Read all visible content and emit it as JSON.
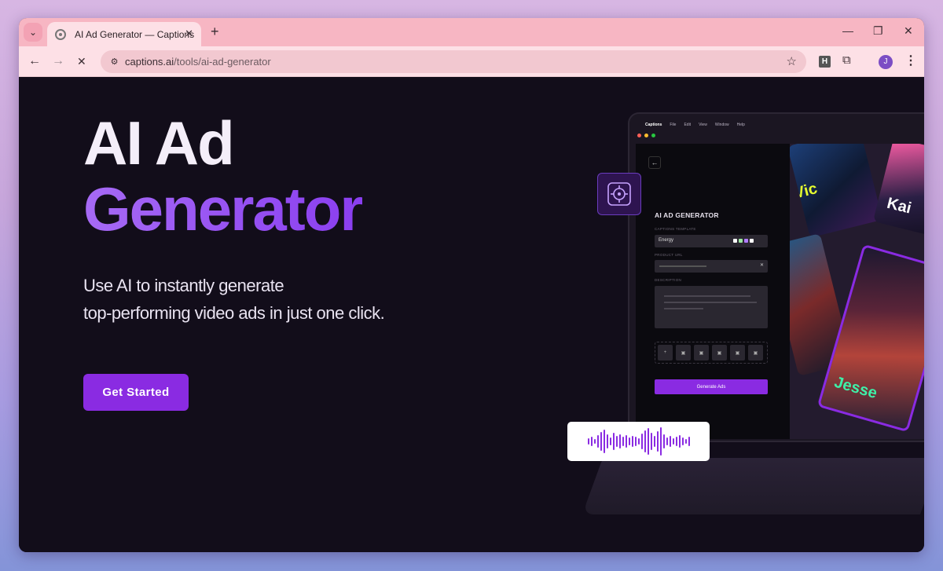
{
  "browser": {
    "tab_title": "AI Ad Generator — Captions",
    "tab_close": "✕",
    "new_tab": "+",
    "url_domain": "captions.ai",
    "url_path": "/tools/ai-ad-generator",
    "extension_h": "H",
    "profile_initial": "J"
  },
  "hero": {
    "title_line1": "AI Ad",
    "title_line2": "Generator",
    "subtitle_line1": "Use AI to instantly generate",
    "subtitle_line2": "top-performing video ads in just one click.",
    "cta_label": "Get Started"
  },
  "app_mockup": {
    "menubar": [
      "Captions",
      "File",
      "Edit",
      "View",
      "Window",
      "Help"
    ],
    "panel_title": "AI AD GENERATOR",
    "template_label": "CAPTIONS TEMPLATE",
    "template_value": "Energy",
    "product_url_label": "PRODUCT URL",
    "description_label": "DESCRIPTION",
    "generate_button": "Generate Ads",
    "names": [
      "Vic",
      "Kai",
      "Jesse"
    ]
  },
  "colors": {
    "accent": "#8a2be2",
    "page_bg": "#120d1a",
    "tab_bar": "#f7b6c3"
  }
}
